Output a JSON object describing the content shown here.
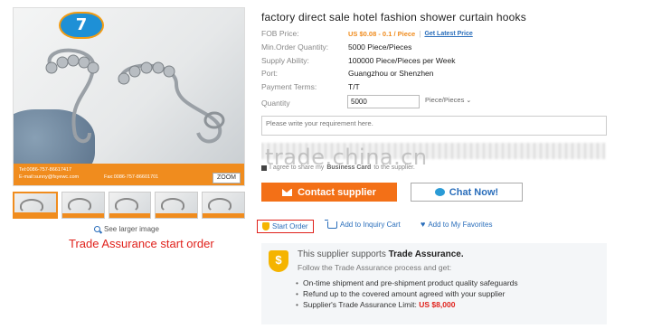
{
  "product": {
    "title": "factory direct sale hotel fashion shower curtain hooks",
    "logo_text": "7",
    "photo_band_left": "Tel:0086-757-86617417\nE-mail:sunny@fsyewc.com",
    "photo_band_right": "Fax:0086-757-86601701",
    "zoom_label": "ZOOM",
    "see_larger_label": "See larger image",
    "thumbnail_count": 5
  },
  "annotation": {
    "caption": "Trade Assurance start order"
  },
  "attributes": {
    "fob_label": "FOB Price:",
    "fob_value": "US $0.08 - 0.1 / Piece",
    "latest_price_link": "Get Latest Price",
    "moq_label": "Min.Order Quantity:",
    "moq_value": "5000 Piece/Pieces",
    "supply_label": "Supply Ability:",
    "supply_value": "100000 Piece/Pieces per Week",
    "port_label": "Port:",
    "port_value": "Guangzhou or Shenzhen",
    "payment_label": "Payment Terms:",
    "payment_value": "T/T",
    "quantity_label": "Quantity",
    "quantity_value": "5000",
    "quantity_unit": "Piece/Pieces"
  },
  "requirement": {
    "placeholder": "Please write your requirement here."
  },
  "watermark": "trade.china.cn",
  "share": {
    "prefix": "I agree to share my",
    "bold": "Business Card",
    "suffix": "to the supplier."
  },
  "buttons": {
    "contact": "Contact supplier",
    "chat": "Chat Now!",
    "start_order": "Start Order",
    "inquiry_cart": "Add to Inquiry Cart",
    "favorites": "Add to My Favorites"
  },
  "trade_assurance": {
    "head_prefix": "This supplier supports",
    "head_bold": "Trade Assurance.",
    "subtitle": "Follow the Trade Assurance process and get:",
    "items": [
      "On-time shipment and pre-shipment product quality safeguards",
      "Refund up to the covered amount agreed with your supplier"
    ],
    "limit_label": "Supplier's Trade Assurance Limit:",
    "limit_value": "US $8,000"
  },
  "colors": {
    "accent_orange": "#f37017",
    "link_blue": "#2a6ebb",
    "annotation_red": "#e0211b"
  }
}
